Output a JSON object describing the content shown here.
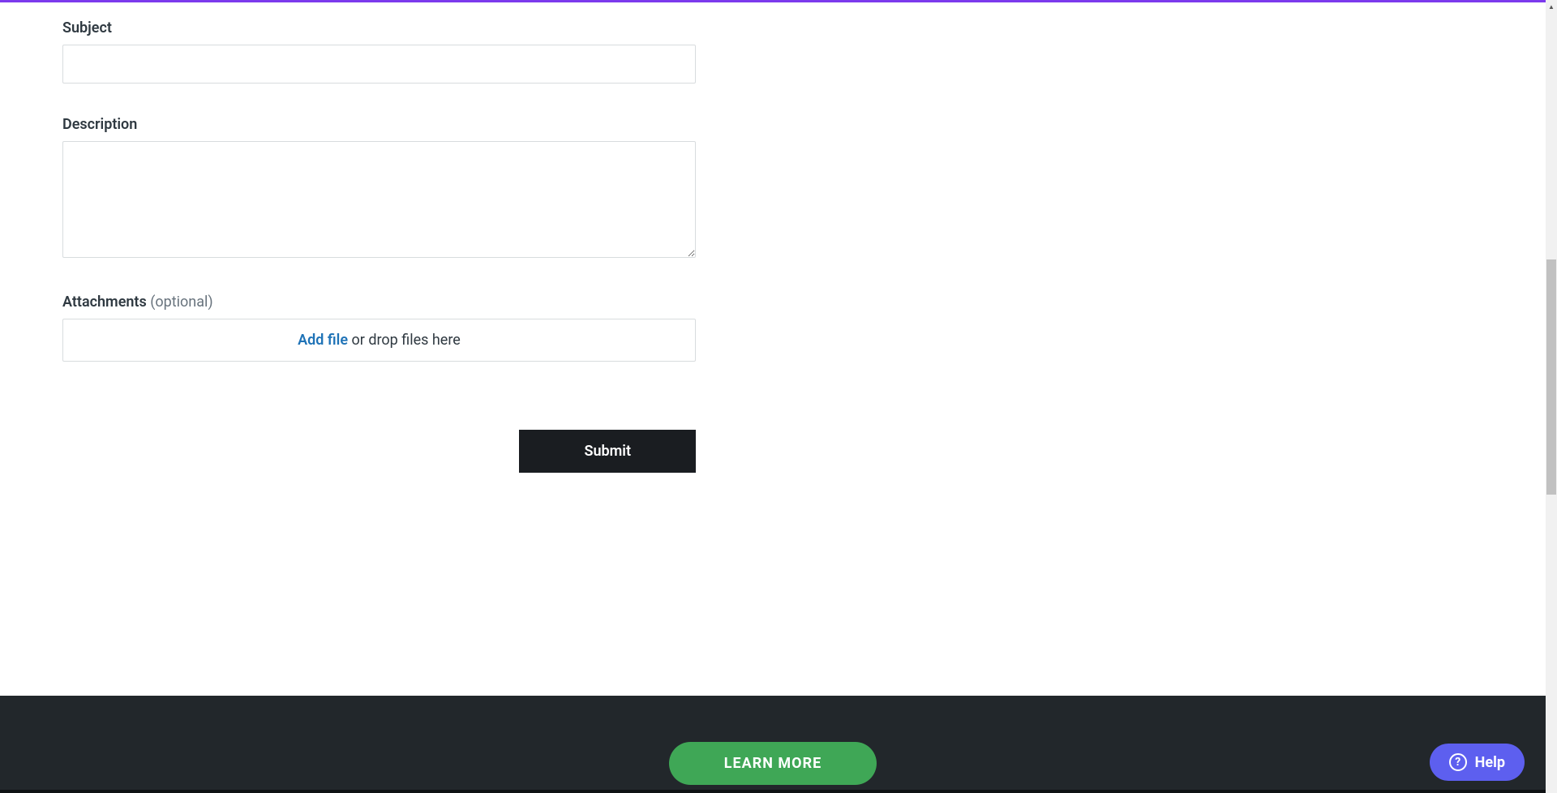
{
  "form": {
    "subject": {
      "label": "Subject",
      "value": ""
    },
    "description": {
      "label": "Description",
      "value": ""
    },
    "attachments": {
      "label": "Attachments",
      "optional": "(optional)",
      "add_file": "Add file",
      "drop_hint": " or drop files here"
    },
    "submit_label": "Submit"
  },
  "footer": {
    "learn_more_label": "LEARN MORE"
  },
  "help": {
    "label": "Help",
    "icon_glyph": "?"
  }
}
